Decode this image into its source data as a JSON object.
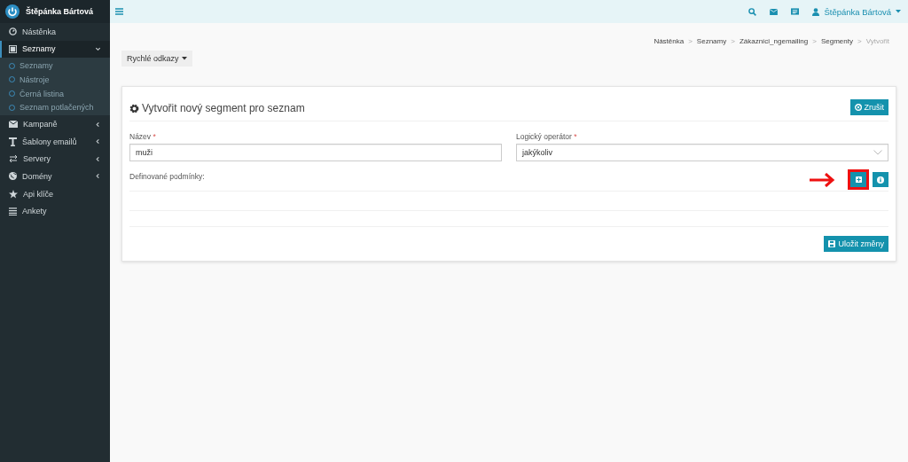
{
  "sidebar": {
    "user_name": "Štěpánka Bártová",
    "items": [
      {
        "label": "Nástěnka",
        "kind": "link",
        "selected": false
      },
      {
        "label": "Seznamy",
        "kind": "group",
        "selected": true,
        "expanded": true,
        "children": [
          {
            "label": "Seznamy"
          },
          {
            "label": "Nástroje"
          },
          {
            "label": "Černá listina"
          },
          {
            "label": "Seznam potlačených"
          }
        ]
      },
      {
        "label": "Kampaně",
        "kind": "group",
        "selected": false,
        "expanded": false
      },
      {
        "label": "Šablony emailů",
        "kind": "group",
        "selected": false,
        "expanded": false
      },
      {
        "label": "Servery",
        "kind": "group",
        "selected": false,
        "expanded": false
      },
      {
        "label": "Domény",
        "kind": "group",
        "selected": false,
        "expanded": false
      },
      {
        "label": "Api klíče",
        "kind": "link",
        "selected": false
      },
      {
        "label": "Ankety",
        "kind": "link",
        "selected": false
      }
    ]
  },
  "topbar": {
    "user_name": "Štěpánka Bártová"
  },
  "breadcrumb": [
    {
      "label": "Nástěnka",
      "current": false
    },
    {
      "separator": ">",
      "label": "Seznamy",
      "current": false
    },
    {
      "separator": ">",
      "label": "Zákazníci_ngemailing",
      "current": false
    },
    {
      "separator": ">",
      "label": "Segmenty",
      "current": false
    },
    {
      "separator": ">",
      "label": "Vytvořit",
      "current": true
    }
  ],
  "quick_links": {
    "label": "Rychlé odkazy"
  },
  "card": {
    "title": "Vytvořit nový segment pro seznam",
    "cancel_button": "Zrušit",
    "fields": [
      {
        "kind": "text",
        "label": "Název",
        "required_mark": "*",
        "value": "muži"
      },
      {
        "kind": "select",
        "label": "Logický operátor",
        "required_mark": "*",
        "value": "jakýkoliv"
      }
    ],
    "conditions_label": "Definované podmínky:",
    "add_button": {
      "highlighted": true
    },
    "save_button": "Uložit změny"
  }
}
